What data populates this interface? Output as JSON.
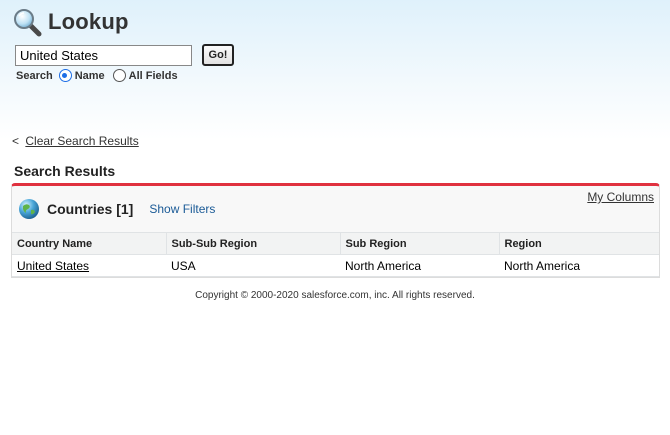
{
  "header": {
    "title": "Lookup",
    "icon": "magnifier-icon"
  },
  "search": {
    "value": "United States",
    "go_label": "Go!",
    "scope_label": "Search",
    "options": [
      {
        "label": "Name",
        "selected": true
      },
      {
        "label": "All Fields",
        "selected": false
      }
    ]
  },
  "clear": {
    "prefix": "<",
    "label": "Clear Search Results"
  },
  "results": {
    "section_title": "Search Results",
    "accent_color": "#e0313f",
    "panel_title": "Countries [1]",
    "show_filters_label": "Show Filters",
    "my_columns_label": "My Columns",
    "columns": [
      "Country Name",
      "Sub-Sub Region",
      "Sub Region",
      "Region"
    ],
    "rows": [
      {
        "country": "United States",
        "sub_sub_region": "USA",
        "sub_region": "North America",
        "region": "North America"
      }
    ]
  },
  "footer": {
    "copyright": "Copyright © 2000-2020 salesforce.com, inc. All rights reserved."
  }
}
